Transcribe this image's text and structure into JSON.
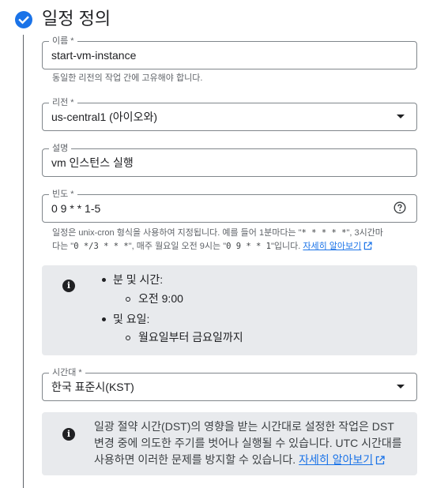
{
  "step": {
    "title": "일정 정의"
  },
  "name_field": {
    "label": "이름 *",
    "value": "start-vm-instance",
    "hint": "동일한 리전의 작업 간에 고유해야 합니다."
  },
  "region_field": {
    "label": "리전 *",
    "value": "us-central1 (아이오와)"
  },
  "description_field": {
    "label": "설명",
    "value": "vm 인스턴스 실행"
  },
  "frequency_field": {
    "label": "빈도 *",
    "value": "0 9 * * 1-5",
    "hint_part1": "일정은 unix-cron 형식을 사용하여 지정됩니다. 예를 들어 1분마다는 \"",
    "hint_code1": "* * * * *",
    "hint_part2": "\", 3시간마",
    "hint_part3": "다는 \"",
    "hint_code2": "0 */3 * * *",
    "hint_part4": "\", 매주 월요일 오전 9시는 \"",
    "hint_code3": "0 9 * * 1",
    "hint_part5": "\"입니다. ",
    "hint_link": "자세히 알아보기"
  },
  "schedule_summary": {
    "time_heading": "분 및 시간:",
    "time_value": "오전 9:00",
    "day_heading": "및 요일:",
    "day_value": "월요일부터 금요일까지"
  },
  "timezone_field": {
    "label": "시간대 *",
    "value": "한국 표준시(KST)"
  },
  "dst_notice": {
    "text": "일광 절약 시간(DST)의 영향을 받는 시간대로 설정한 작업은 DST 변경 중에 의도한 주기를 벗어나 실행될 수 있습니다. UTC 시간대를 사용하면 이러한 문제를 방지할 수 있습니다. ",
    "link": "자세히 알아보기"
  },
  "colors": {
    "accent": "#1a73e8",
    "info_bg": "#e8eaed",
    "border": "#80868b"
  },
  "icons": [
    "check-circle-icon",
    "dropdown-arrow-icon",
    "help-icon",
    "external-link-icon",
    "info-icon"
  ]
}
